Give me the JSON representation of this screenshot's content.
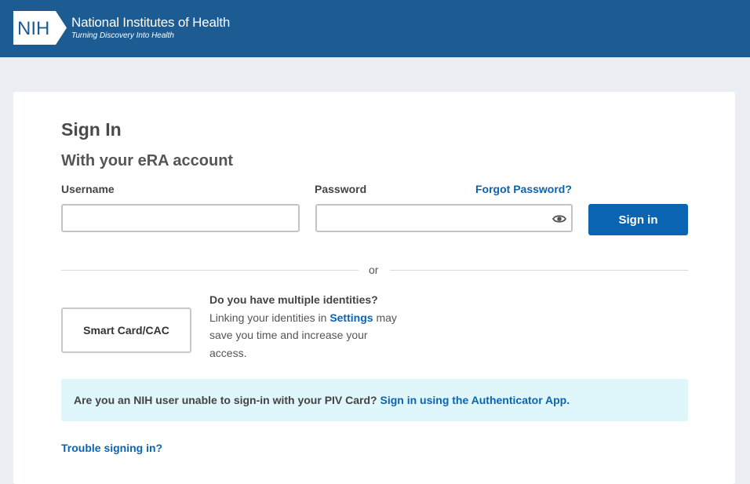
{
  "header": {
    "logo_abbr": "NIH",
    "org_name": "National Institutes of Health",
    "tagline": "Turning Discovery Into Health"
  },
  "signin": {
    "title": "Sign In",
    "subtitle": "With your eRA account",
    "username_label": "Username",
    "username_value": "",
    "password_label": "Password",
    "password_value": "",
    "forgot_password": "Forgot Password?",
    "submit_label": "Sign in"
  },
  "alternative": {
    "or_text": "or",
    "smart_card_label": "Smart Card/CAC",
    "identities_question": "Do you have multiple identities?",
    "identities_text_before": "Linking your identities in",
    "identities_link": "Settings",
    "identities_text_after": "may save you time and increase your access."
  },
  "piv_notice": {
    "question": "Are you an NIH user unable to sign-in with your PIV Card?",
    "link": "Sign in using the Authenticator App."
  },
  "help": {
    "trouble_link": "Trouble signing in?"
  },
  "icons": {
    "password_toggle": "eye-icon"
  },
  "colors": {
    "header_bg": "#1c5c93",
    "primary": "#0b64b2",
    "page_bg": "#ebeff4",
    "notice_bg": "#dff6fb"
  }
}
